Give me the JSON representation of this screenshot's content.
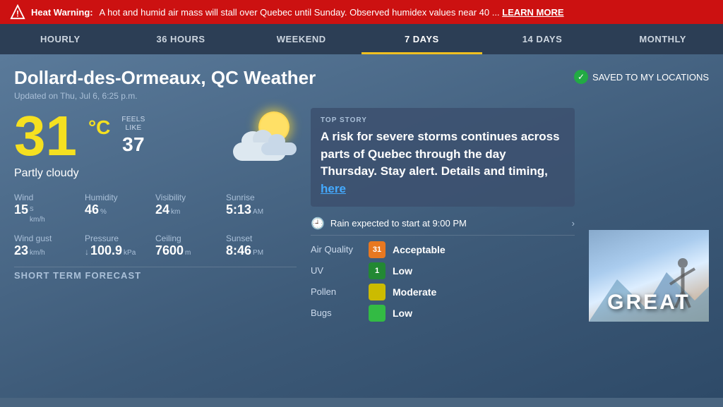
{
  "warning": {
    "label": "Heat Warning:",
    "text": "A hot and humid air mass will stall over Quebec until Sunday. Observed humidex values near 40 ...",
    "learn_more": "LEARN MORE"
  },
  "nav": {
    "tabs": [
      {
        "id": "hourly",
        "label": "HOURLY",
        "active": false
      },
      {
        "id": "36hours",
        "label": "36 HOURS",
        "active": false
      },
      {
        "id": "weekend",
        "label": "WEEKEND",
        "active": false
      },
      {
        "id": "7days",
        "label": "7 DAYS",
        "active": true
      },
      {
        "id": "14days",
        "label": "14 DAYS",
        "active": false
      },
      {
        "id": "monthly",
        "label": "MONTHLY",
        "active": false
      }
    ]
  },
  "location": {
    "title": "Dollard-des-Ormeaux, QC Weather",
    "updated": "Updated on Thu, Jul 6, 6:25 p.m.",
    "saved_label": "SAVED TO MY LOCATIONS"
  },
  "current": {
    "temp": "31",
    "unit": "°C",
    "feels_like_label": "FEELS LIKE",
    "feels_like": "37",
    "condition": "Partly cloudy"
  },
  "stats": {
    "wind_label": "Wind",
    "wind_value": "15",
    "wind_unit": "km/h",
    "wind_dir": "S",
    "humidity_label": "Humidity",
    "humidity_value": "46",
    "humidity_unit": "%",
    "visibility_label": "Visibility",
    "visibility_value": "24",
    "visibility_unit": "km",
    "sunrise_label": "Sunrise",
    "sunrise_value": "5:13",
    "sunrise_unit": "AM",
    "wind_gust_label": "Wind gust",
    "wind_gust_value": "23",
    "wind_gust_unit": "km/h",
    "pressure_label": "Pressure",
    "pressure_arrow": "↓",
    "pressure_value": "100.9",
    "pressure_unit": "kPa",
    "ceiling_label": "Ceiling",
    "ceiling_value": "7600",
    "ceiling_unit": "m",
    "sunset_label": "Sunset",
    "sunset_value": "8:46",
    "sunset_unit": "PM"
  },
  "top_story": {
    "label": "TOP STORY",
    "text": "A risk for severe storms continues across parts of Quebec through the day Thursday. Stay alert. Details and timing, here"
  },
  "rain_alert": {
    "text": "Rain expected to start at 9:00 PM"
  },
  "conditions": [
    {
      "label": "Air Quality",
      "badge": "31",
      "badge_class": "badge-orange",
      "status": "Acceptable"
    },
    {
      "label": "UV",
      "badge": "1",
      "badge_class": "badge-green-dark",
      "status": "Low"
    },
    {
      "label": "Pollen",
      "badge": "",
      "badge_class": "badge-yellow",
      "status": "Moderate"
    },
    {
      "label": "Bugs",
      "badge": "",
      "badge_class": "badge-green",
      "status": "Low"
    }
  ],
  "short_term": {
    "label": "SHORT TERM FORECAST"
  },
  "video_thumb": {
    "text": "GREAT"
  }
}
